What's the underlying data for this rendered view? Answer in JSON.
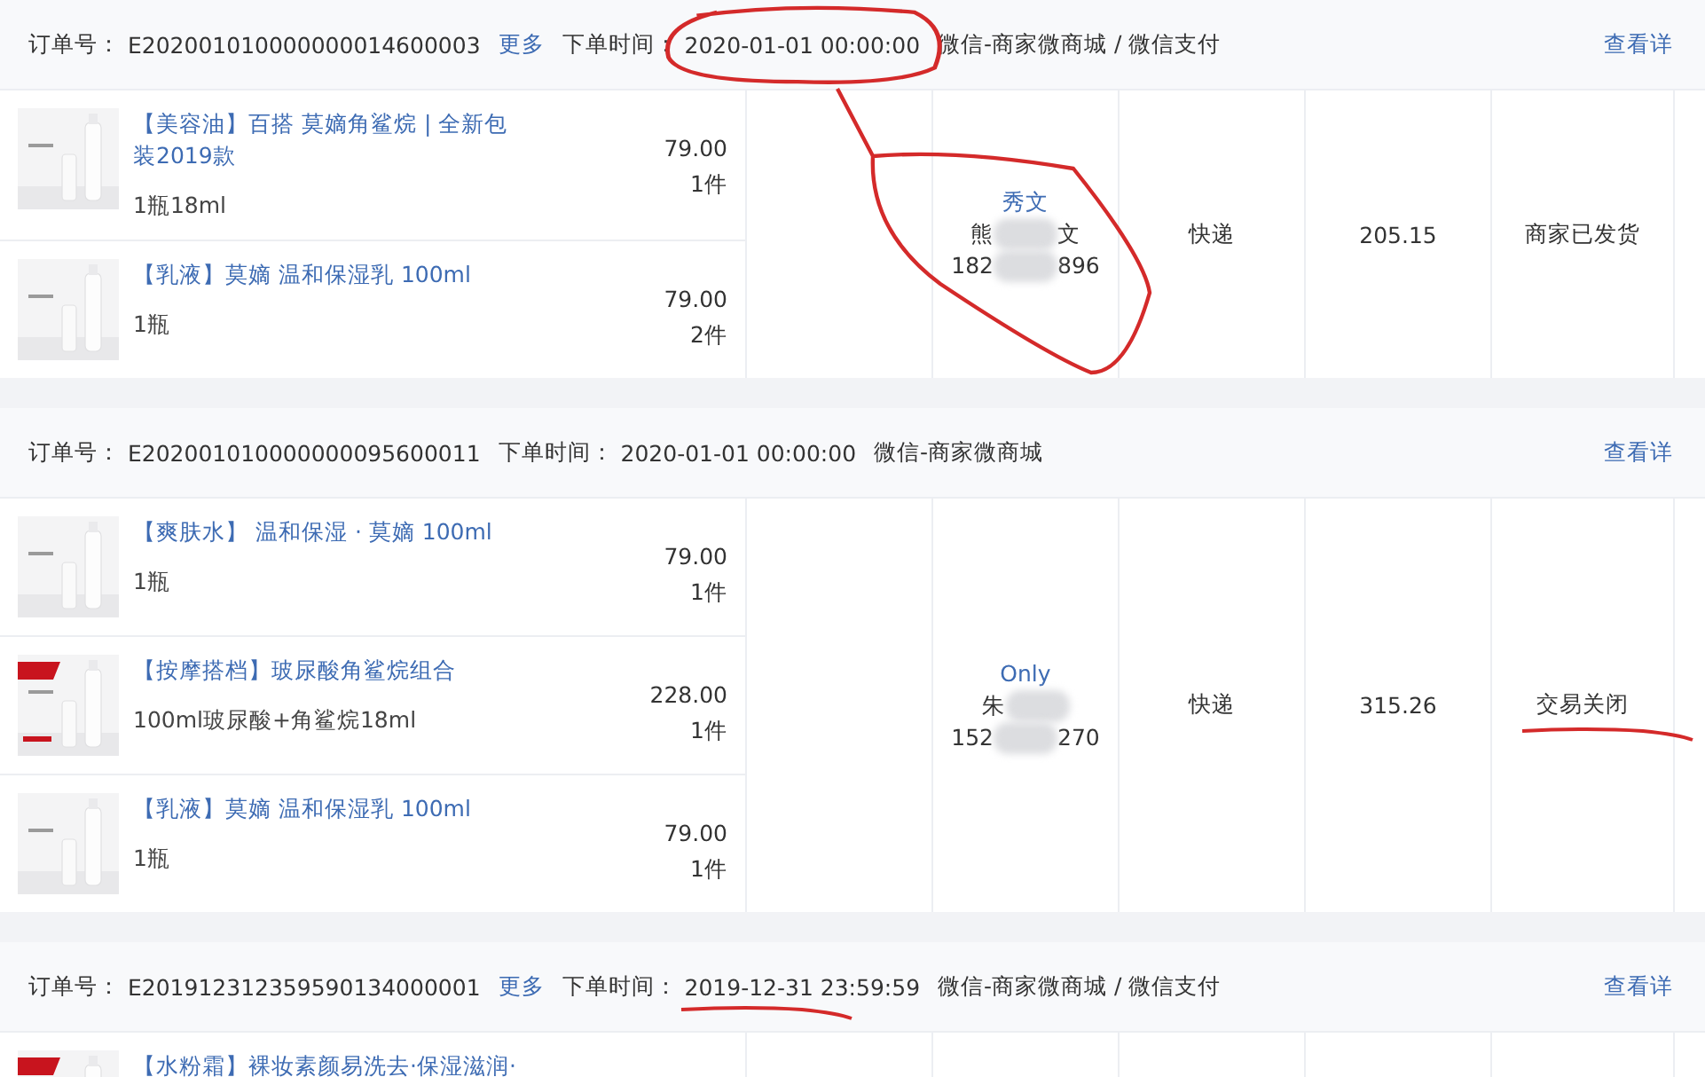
{
  "orders": [
    {
      "order_no_label": "订单号：",
      "order_no": "E202001010000000014600003",
      "more_link": "更多",
      "time_label": "下单时间：",
      "time": "2020-01-01 00:00:00",
      "time_circled": true,
      "time_underlined": false,
      "channel": "微信-商家微商城 / 微信支付",
      "details_link": "查看详",
      "items": [
        {
          "title": "【美容油】百搭 莫嫡角鲨烷 | 全新包装2019款",
          "spec": "1瓶18ml",
          "price": "79.00",
          "qty": "1件",
          "promo_tag": false
        },
        {
          "title": "【乳液】莫嫡 温和保湿乳 100ml",
          "spec": "1瓶",
          "price": "79.00",
          "qty": "2件",
          "promo_tag": false
        }
      ],
      "customer": {
        "nickname": "秀文",
        "name_start": "熊",
        "name_end": "文",
        "phone_start": "182",
        "phone_end": "896",
        "circled": true
      },
      "delivery": "快递",
      "amount": "205.15",
      "status": "商家已发货",
      "status_underlined": false
    },
    {
      "order_no_label": "订单号：",
      "order_no": "E202001010000000095600011",
      "time_label": "下单时间：",
      "time": "2020-01-01 00:00:00",
      "time_circled": false,
      "time_underlined": false,
      "channel": "微信-商家微商城",
      "details_link": "查看详",
      "items": [
        {
          "title": "【爽肤水】 温和保湿 · 莫嫡 100ml",
          "spec": "1瓶",
          "price": "79.00",
          "qty": "1件",
          "promo_tag": false
        },
        {
          "title": "【按摩搭档】玻尿酸角鲨烷组合",
          "spec": "100ml玻尿酸+角鲨烷18ml",
          "price": "228.00",
          "qty": "1件",
          "promo_tag": true
        },
        {
          "title": "【乳液】莫嫡 温和保湿乳 100ml",
          "spec": "1瓶",
          "price": "79.00",
          "qty": "1件",
          "promo_tag": false
        }
      ],
      "customer": {
        "nickname": "Only",
        "name_start": "朱",
        "phone_start": "152",
        "phone_end": "270",
        "circled": false
      },
      "delivery": "快递",
      "amount": "315.26",
      "status": "交易关闭",
      "status_underlined": true
    },
    {
      "order_no_label": "订单号：",
      "order_no": "E201912312359590134000001",
      "more_link": "更多",
      "time_label": "下单时间：",
      "time": "2019-12-31 23:59:59",
      "time_circled": false,
      "time_underlined": true,
      "channel": "微信-商家微商城 / 微信支付",
      "details_link": "查看详",
      "items": [
        {
          "title": "【水粉霜】裸妆素颜易洗去·保湿滋润·",
          "promo_tag": true
        }
      ]
    }
  ]
}
